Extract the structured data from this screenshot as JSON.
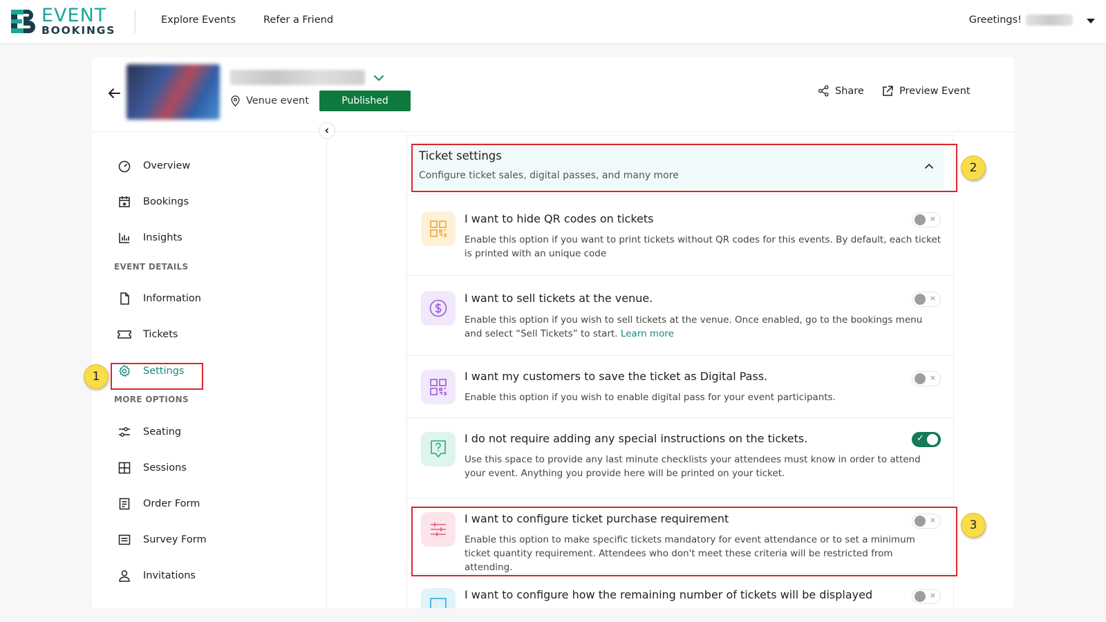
{
  "topbar": {
    "logo_line1": "EVENT",
    "logo_line2": "BOOKINGS",
    "nav": [
      {
        "label": "Explore Events"
      },
      {
        "label": "Refer a Friend"
      }
    ],
    "greeting": "Greetings!"
  },
  "event": {
    "venue_type": "Venue event",
    "status": "Published",
    "share_label": "Share",
    "preview_label": "Preview Event"
  },
  "sidebar": {
    "items": [
      {
        "label": "Overview",
        "icon": "gauge-icon"
      },
      {
        "label": "Bookings",
        "icon": "calendar-icon"
      },
      {
        "label": "Insights",
        "icon": "bar-chart-icon"
      }
    ],
    "section_event_details": "EVENT DETAILS",
    "details_items": [
      {
        "label": "Information",
        "icon": "document-icon"
      },
      {
        "label": "Tickets",
        "icon": "ticket-icon"
      },
      {
        "label": "Settings",
        "icon": "gear-icon"
      }
    ],
    "section_more_options": "MORE OPTIONS",
    "more_items": [
      {
        "label": "Seating",
        "icon": "sliders-icon"
      },
      {
        "label": "Sessions",
        "icon": "grid-icon"
      },
      {
        "label": "Order Form",
        "icon": "form-icon"
      },
      {
        "label": "Survey Form",
        "icon": "survey-icon"
      },
      {
        "label": "Invitations",
        "icon": "user-icon"
      }
    ]
  },
  "panel": {
    "title": "Ticket settings",
    "subtitle": "Configure ticket sales, digital passes, and many more",
    "rows": [
      {
        "title": "I want to hide QR codes on tickets",
        "desc": "Enable this option if you want to print tickets without QR codes for this events. By default, each ticket is printed with an unique code",
        "icon": "qr-code-icon",
        "enabled": false
      },
      {
        "title": "I want to sell tickets at the venue.",
        "desc": "Enable this option if you wish to sell tickets at the venue. Once enabled, go to the bookings menu and select “Sell Tickets” to start.",
        "link": "Learn more",
        "icon": "dollar-icon",
        "enabled": false
      },
      {
        "title": "I want my customers to save the ticket as Digital Pass.",
        "desc": "Enable this option if you wish to enable digital pass for your event participants.",
        "icon": "qr-code-icon",
        "enabled": false
      },
      {
        "title": "I do not require adding any special instructions on the tickets.",
        "desc": "Use this space to provide any last minute checklists your attendees must know in order to attend your event. Anything you provide here will be printed on your ticket.",
        "icon": "question-icon",
        "enabled": true
      },
      {
        "title": "I want to configure ticket purchase requirement",
        "desc": "Enable this option to make specific tickets mandatory for event attendance or to set a minimum ticket quantity requirement. Attendees who don't meet these criteria will be restricted from attending.",
        "icon": "sliders-icon",
        "enabled": false
      },
      {
        "title": "I want to configure how the remaining number of tickets will be displayed",
        "icon": "display-icon",
        "enabled": false
      }
    ]
  },
  "annotations": [
    "1",
    "2",
    "3"
  ],
  "toggle_symbols": {
    "off": "×",
    "on": "✓"
  },
  "colors": {
    "accent": "#148a7c",
    "published": "#0f7a3f",
    "toggle_on": "#157a5a",
    "highlight": "#d8262b",
    "callout": "#f8dc4a"
  }
}
